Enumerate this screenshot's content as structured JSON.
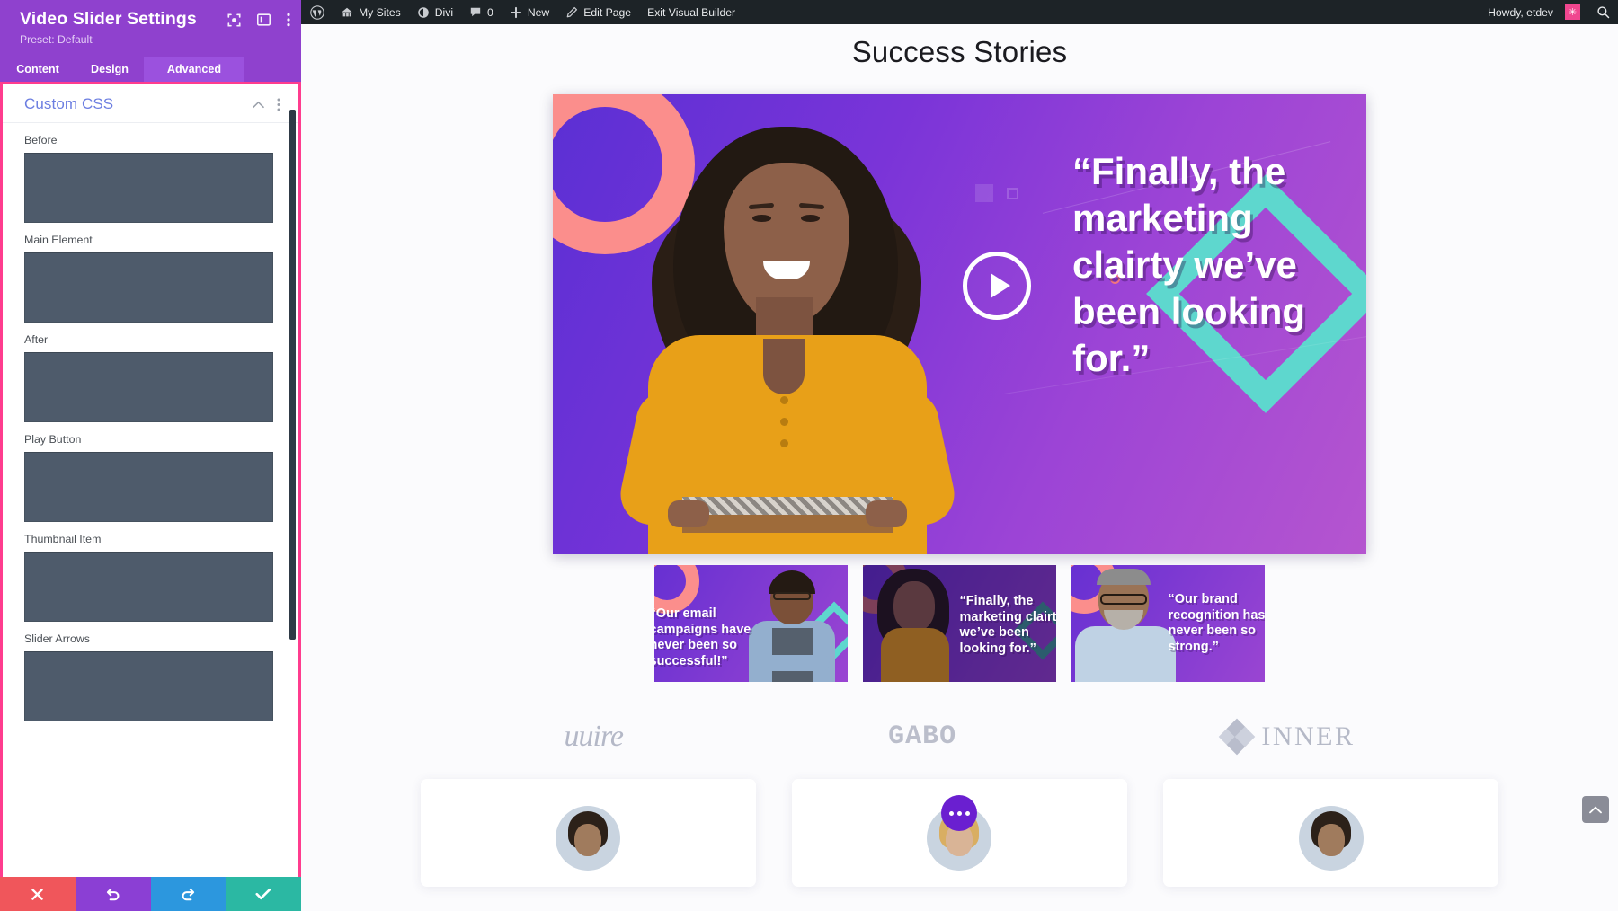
{
  "panel": {
    "title": "Video Slider Settings",
    "preset": "Preset: Default",
    "header_icons": [
      "target-icon",
      "layout-panel-icon",
      "more-vertical-icon"
    ],
    "tabs": [
      {
        "label": "Content",
        "active": false
      },
      {
        "label": "Design",
        "active": false
      },
      {
        "label": "Advanced",
        "active": true
      }
    ],
    "section": {
      "title": "Custom CSS",
      "collapse_icon": "chevron-up-icon",
      "more_icon": "more-vertical-icon"
    },
    "fields": [
      {
        "label": "Before",
        "value": ""
      },
      {
        "label": "Main Element",
        "value": ""
      },
      {
        "label": "After",
        "value": ""
      },
      {
        "label": "Play Button",
        "value": ""
      },
      {
        "label": "Thumbnail Item",
        "value": ""
      },
      {
        "label": "Slider Arrows",
        "value": ""
      }
    ],
    "actions": [
      {
        "name": "cancel",
        "icon": "✕",
        "color": "#F0565B"
      },
      {
        "name": "undo",
        "icon": "↺",
        "color": "#8B3FD4"
      },
      {
        "name": "redo",
        "icon": "↻",
        "color": "#2C97DE"
      },
      {
        "name": "save",
        "icon": "✓",
        "color": "#2BB8A3"
      }
    ],
    "accent_border": "#FF3C8E",
    "header_bg": "#8F41CE",
    "active_tab_bg": "#9B51DE",
    "textarea_bg": "#4E5B6B",
    "section_title_color": "#6C7EE1"
  },
  "adminbar": {
    "items": [
      {
        "label": "",
        "icon": "wordpress-icon"
      },
      {
        "label": "My Sites",
        "icon": "sites-icon"
      },
      {
        "label": "Divi",
        "icon": "divi-icon"
      },
      {
        "label": "0",
        "icon": "comment-icon"
      },
      {
        "label": "New",
        "icon": "plus-icon"
      },
      {
        "label": "Edit Page",
        "icon": "pencil-icon"
      },
      {
        "label": "Exit Visual Builder",
        "icon": ""
      }
    ],
    "howdy": "Howdy, etdev",
    "avatar_color": "#F0468F",
    "search_icon": "search-icon",
    "bg": "#1D2327"
  },
  "page": {
    "title": "Success Stories",
    "slide": {
      "quote": "“Finally, the marketing clairty we’ve been looking for.”",
      "play_icon": "play-icon"
    },
    "thumbnails": [
      {
        "quote": "“Our email campaigns have never been so successful!”",
        "active": false
      },
      {
        "quote": "“Finally, the marketing clairty we’ve been looking for.”",
        "active": true
      },
      {
        "quote": "“Our brand recognition has never been so strong.”",
        "active": false
      }
    ],
    "logos": [
      {
        "name": "uuire",
        "style": "script"
      },
      {
        "name": "GABO",
        "style": "mono"
      },
      {
        "name": "INNER",
        "style": "serif",
        "icon": "diamond-cluster-icon"
      }
    ],
    "cards": [
      {
        "avatar": "avatar-man",
        "badge": null
      },
      {
        "avatar": "avatar-woman",
        "badge": "more-dots-badge"
      },
      {
        "avatar": "avatar-woman-2",
        "badge": null
      }
    ],
    "scroll_top_icon": "chevron-up-icon",
    "bg": "#fbfbfd"
  }
}
